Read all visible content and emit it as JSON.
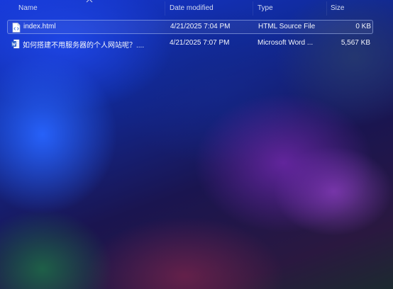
{
  "columns": {
    "name": "Name",
    "date_modified": "Date modified",
    "type": "Type",
    "size": "Size"
  },
  "sort": {
    "column": "name",
    "direction": "ascending",
    "icon": "chevron-up-icon"
  },
  "files": [
    {
      "name": "index.html",
      "date_modified": "4/21/2025 7:04 PM",
      "type": "HTML Source File",
      "size": "0 KB",
      "icon": "html-file-icon",
      "selected": true
    },
    {
      "name": "如何搭建不用服务器的个人网站呢？....",
      "date_modified": "4/21/2025 7:07 PM",
      "type": "Microsoft Word ...",
      "size": "5,567 KB",
      "icon": "word-document-icon",
      "selected": false
    }
  ],
  "colors": {
    "selection_border": "#aabef0",
    "word_blue": "#2b5fc7",
    "text": "#f3f5fb"
  }
}
